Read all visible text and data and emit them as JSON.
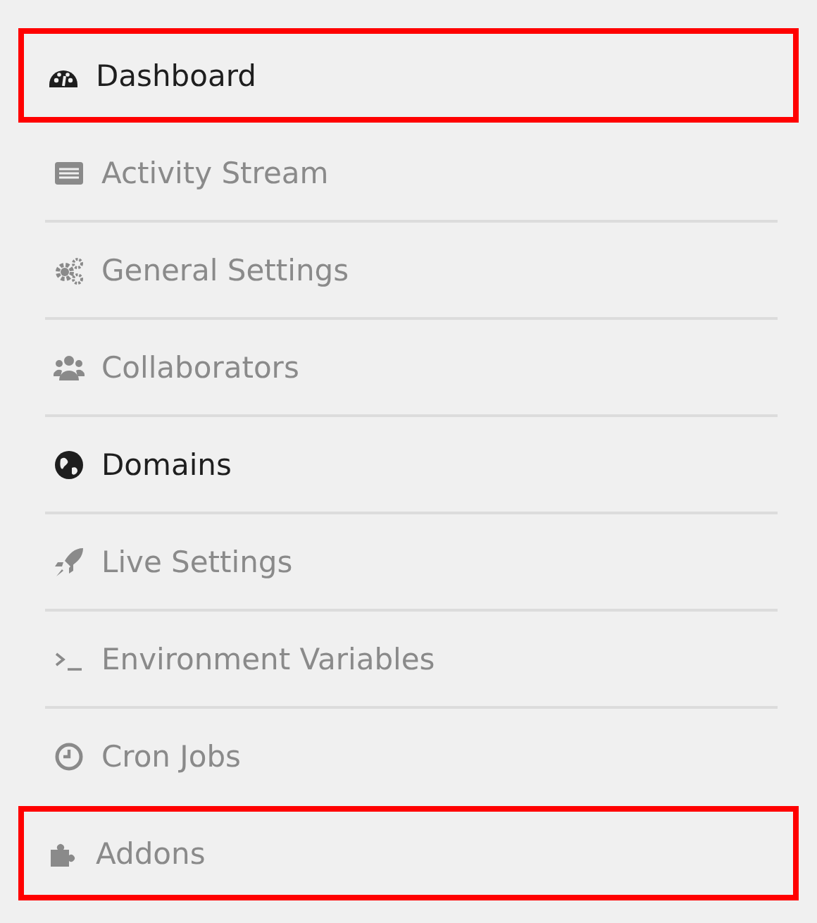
{
  "menu": {
    "items": [
      {
        "label": "Dashboard",
        "active": true,
        "highlighted": true
      },
      {
        "label": "Activity Stream",
        "active": false,
        "highlighted": false
      },
      {
        "label": "General Settings",
        "active": false,
        "highlighted": false
      },
      {
        "label": "Collaborators",
        "active": false,
        "highlighted": false
      },
      {
        "label": "Domains",
        "active": true,
        "highlighted": false
      },
      {
        "label": "Live Settings",
        "active": false,
        "highlighted": false
      },
      {
        "label": "Environment Variables",
        "active": false,
        "highlighted": false
      },
      {
        "label": "Cron Jobs",
        "active": false,
        "highlighted": false
      },
      {
        "label": "Addons",
        "active": false,
        "highlighted": true
      }
    ]
  }
}
